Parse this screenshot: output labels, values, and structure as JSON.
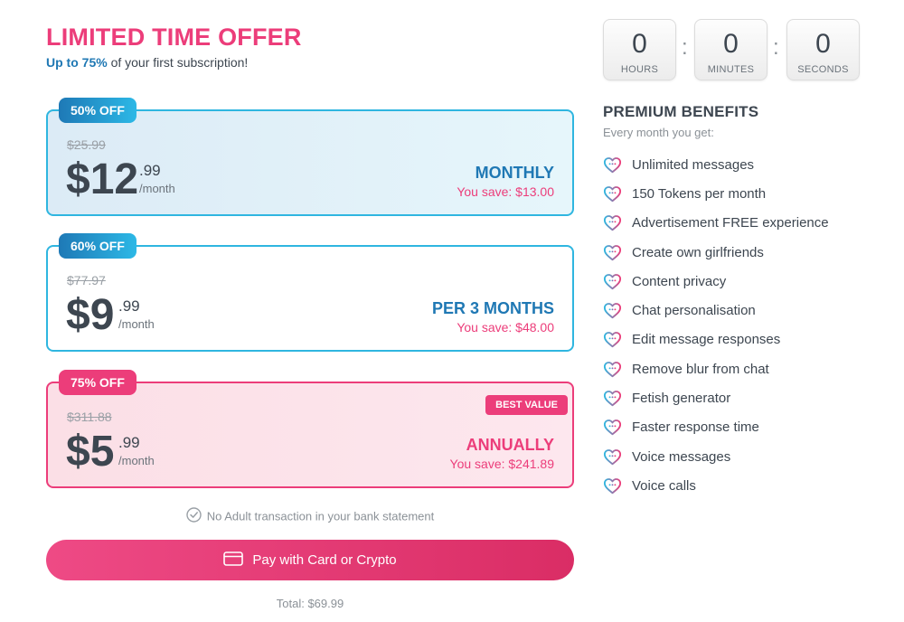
{
  "header": {
    "title": "LIMITED TIME OFFER",
    "subtitle_highlight": "Up to 75%",
    "subtitle_rest": " of your first subscription!"
  },
  "plans": [
    {
      "discount_badge": "50% OFF",
      "old_price": "$25.99",
      "price_whole": "$12",
      "price_cents": ".99",
      "per": "/month",
      "period": "MONTHLY",
      "savings": "You save: $13.00"
    },
    {
      "discount_badge": "60% OFF",
      "old_price": "$77.97",
      "price_whole": "$9",
      "price_cents": ".99",
      "per": "/month",
      "period": "PER 3 MONTHS",
      "savings": "You save: $48.00"
    },
    {
      "discount_badge": "75% OFF",
      "old_price": "$311.88",
      "price_whole": "$5",
      "price_cents": ".99",
      "per": "/month",
      "period": "ANNUALLY",
      "savings": "You save: $241.89",
      "best_value_badge": "BEST VALUE"
    }
  ],
  "notice": "No Adult transaction in your bank statement",
  "pay_button": "Pay with Card or Crypto",
  "total": "Total: $69.99",
  "timer": {
    "hours": "0",
    "hours_label": "HOURS",
    "minutes": "0",
    "minutes_label": "MINUTES",
    "seconds": "0",
    "seconds_label": "SECONDS",
    "separator": ":"
  },
  "benefits": {
    "title": "PREMIUM BENEFITS",
    "subtitle": "Every month you get:",
    "items": [
      "Unlimited messages",
      "150 Tokens per month",
      "Advertisement FREE experience",
      "Create own girlfriends",
      "Content privacy",
      "Chat personalisation",
      "Edit message responses",
      "Remove blur from chat",
      "Fetish generator",
      "Faster response time",
      "Voice messages",
      "Voice calls"
    ]
  },
  "colors": {
    "accent_pink": "#ec3d7a",
    "accent_blue": "#1f78b4",
    "border_blue": "#2fb6e0",
    "text_dark": "#3d4650"
  },
  "icons": {
    "benefit_icon": "heart-chat-icon",
    "notice_icon": "check-circle-icon",
    "pay_icon": "credit-card-icon"
  }
}
